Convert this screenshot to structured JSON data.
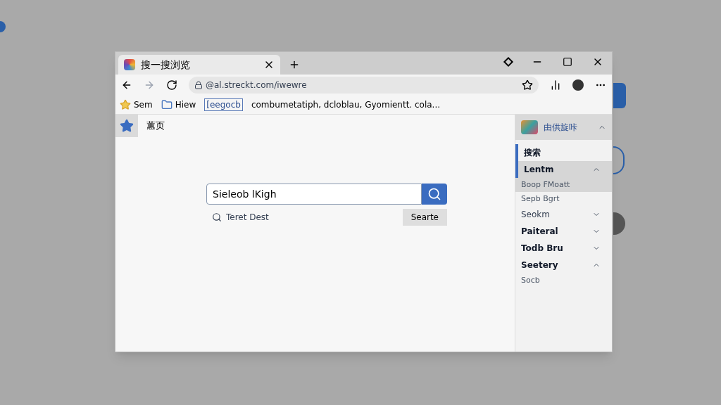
{
  "window": {
    "tab_title": "搜一搜浏览"
  },
  "toolbar": {
    "address": "@al.streckt.com/iwewre",
    "bookmarked": false
  },
  "bookmarks": [
    {
      "label": "Sem",
      "kind": "star"
    },
    {
      "label": "Hiew",
      "kind": "folder"
    },
    {
      "label": "[eegocb",
      "kind": "link"
    },
    {
      "label": "combumetatiph, dcloblau, Gyomientt. cola...",
      "kind": "text"
    }
  ],
  "page": {
    "home_label": "蕙页",
    "search_value": "Sieleob lKigh",
    "hint": "Teret Dest",
    "button": "Searte"
  },
  "sidebar": {
    "title": "由供旋咔",
    "expanded": true,
    "items": [
      {
        "label": "搜索",
        "kind": "section",
        "selected": true
      },
      {
        "label": "Lentm",
        "kind": "section",
        "selected": true,
        "expanded": true,
        "children": [
          {
            "label": "Boop FMoatt",
            "selected": true
          },
          {
            "label": "Sepb Bgrt",
            "selected": false
          }
        ]
      },
      {
        "label": "Seokm",
        "kind": "entry",
        "selected": false,
        "expanded": false
      },
      {
        "label": "Paiteral",
        "kind": "section",
        "selected": false,
        "expanded": false
      },
      {
        "label": "Todb Bru",
        "kind": "section",
        "selected": false,
        "expanded": false
      },
      {
        "label": "Seetery",
        "kind": "section",
        "selected": false,
        "expanded": true,
        "children": [
          {
            "label": "Socb",
            "selected": false
          }
        ]
      }
    ]
  }
}
